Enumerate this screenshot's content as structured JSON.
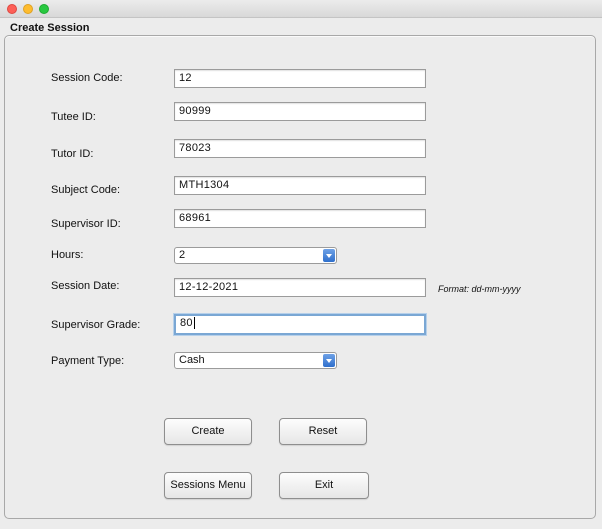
{
  "window": {
    "panel_title": "Create Session"
  },
  "form": {
    "session_code": {
      "label": "Session Code:",
      "value": "12"
    },
    "tutee_id": {
      "label": "Tutee ID:",
      "value": "90999"
    },
    "tutor_id": {
      "label": "Tutor ID:",
      "value": "78023"
    },
    "subject_code": {
      "label": "Subject Code:",
      "value": "MTH1304"
    },
    "supervisor_id": {
      "label": "Supervisor ID:",
      "value": "68961"
    },
    "hours": {
      "label": "Hours:",
      "value": "2"
    },
    "session_date": {
      "label": "Session Date:",
      "value": "12-12-2021",
      "hint": "Format: dd-mm-yyyy"
    },
    "supervisor_grade": {
      "label": "Supervisor Grade:",
      "value": "80"
    },
    "payment_type": {
      "label": "Payment Type:",
      "value": "Cash"
    }
  },
  "buttons": {
    "create": "Create",
    "reset": "Reset",
    "sessions_menu": "Sessions Menu",
    "exit": "Exit"
  },
  "icons": {
    "close": "close-icon",
    "minimize": "minimize-icon",
    "maximize": "maximize-icon",
    "dropdown": "chevron-down-icon"
  },
  "colors": {
    "close": "#fd5f57",
    "minimize": "#febc2e",
    "maximize": "#28c840",
    "combo_arrow": "#3b79d4",
    "focus_ring": "#7aa7d4"
  }
}
